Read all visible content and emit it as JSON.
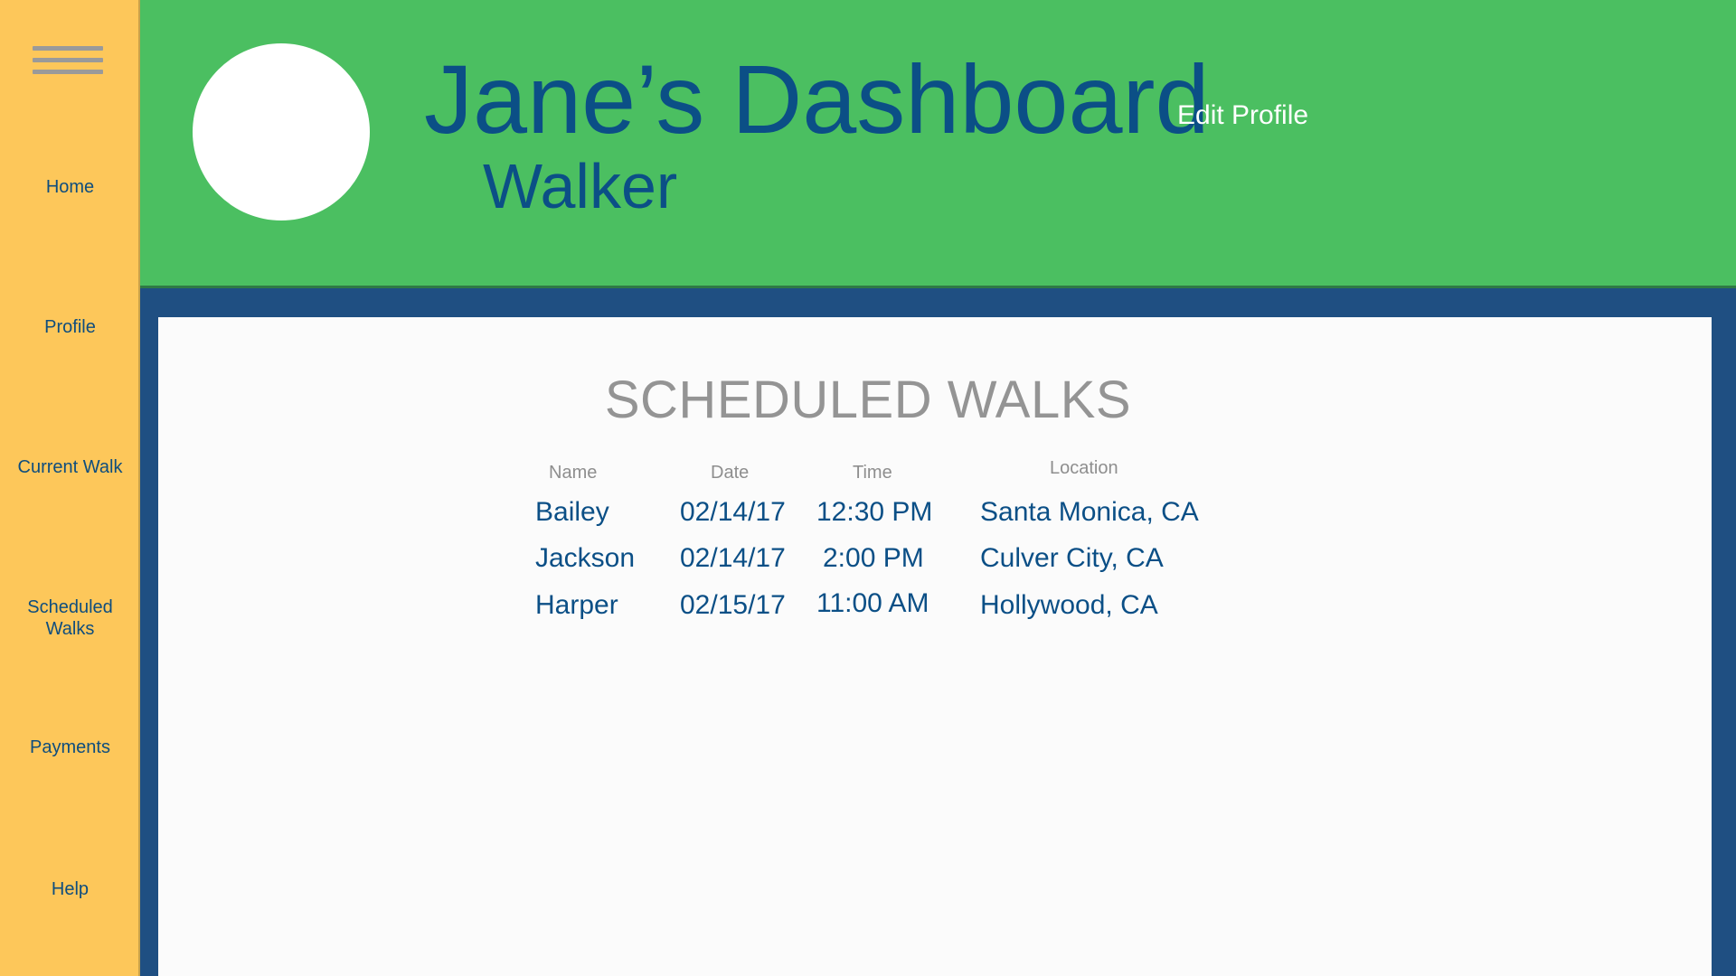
{
  "sidebar": {
    "menu_icon": "hamburger-menu-icon",
    "items": [
      {
        "label": "Home"
      },
      {
        "label": "Profile"
      },
      {
        "label": "Current Walk"
      },
      {
        "label": "Scheduled\nWalks"
      },
      {
        "label": "Payments"
      },
      {
        "label": "Help"
      }
    ]
  },
  "header": {
    "title": "Jane’s Dashboard",
    "subtitle": "Walker",
    "edit_profile_label": "Edit Profile"
  },
  "main": {
    "section_title": "SCHEDULED WALKS",
    "table": {
      "columns": [
        "Name",
        "Date",
        "Time",
        "Location"
      ],
      "rows": [
        [
          "Bailey",
          "02/14/17",
          "12:30 PM",
          "Santa Monica, CA"
        ],
        [
          "Jackson",
          "02/14/17",
          "2:00 PM",
          "Culver City, CA"
        ],
        [
          "Harper",
          "02/15/17",
          "11:00 AM",
          "Hollywood, CA"
        ]
      ]
    }
  },
  "colors": {
    "sidebar_bg": "#fdc75a",
    "header_bg": "#4bbf61",
    "frame_bg": "#1f4f82",
    "text_primary": "#0b4f86",
    "text_muted": "#949494"
  }
}
